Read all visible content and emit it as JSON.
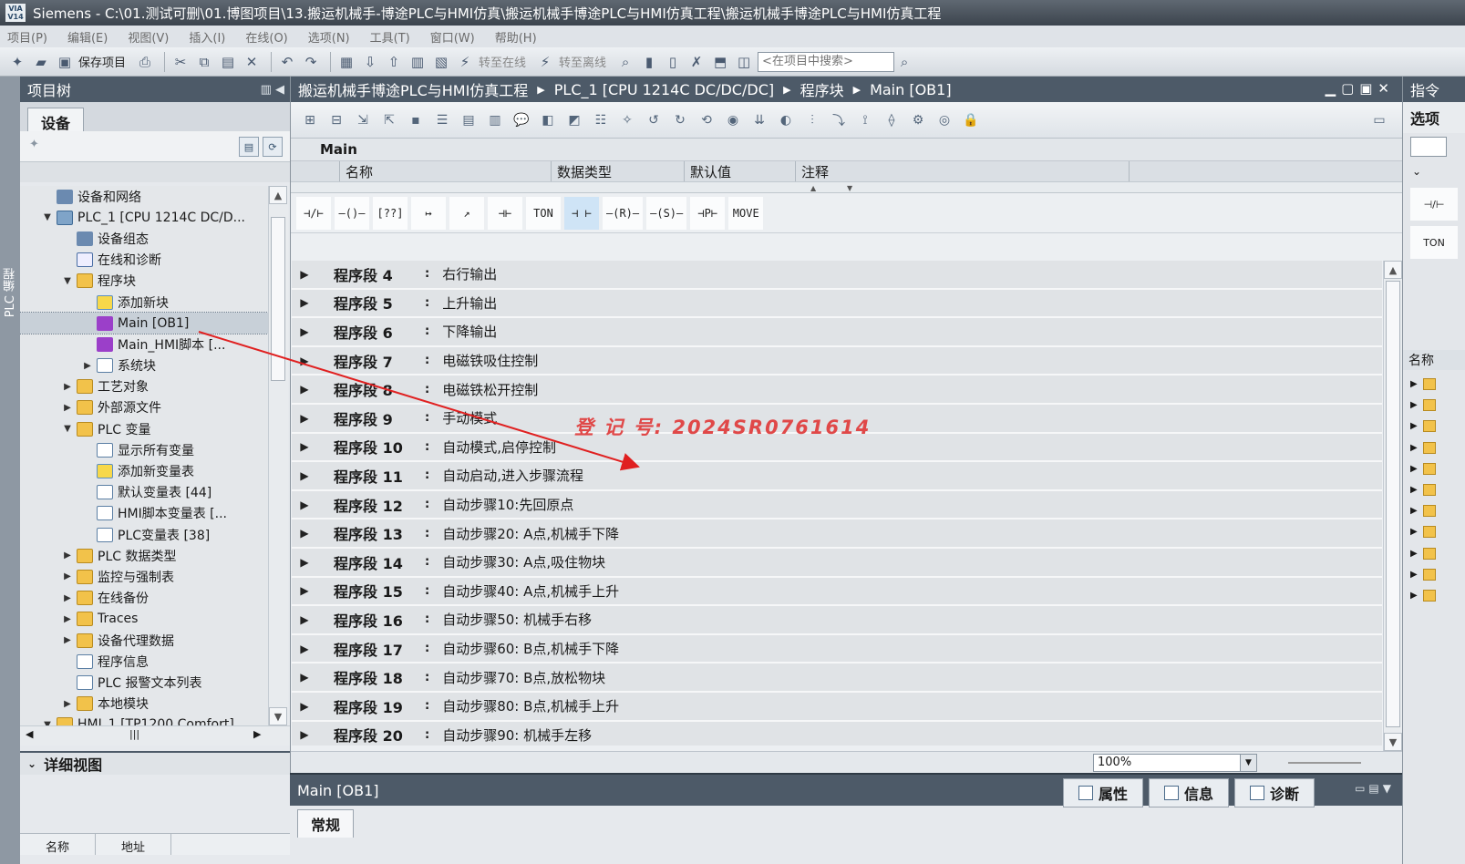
{
  "window": {
    "logo_text": "VIA\nV14",
    "title": "Siemens  -  C:\\01.测试可删\\01.博图项目\\13.搬运机械手-博途PLC与HMI仿真\\搬运机械手博途PLC与HMI仿真工程\\搬运机械手博途PLC与HMI仿真工程"
  },
  "menu": [
    "项目(P)",
    "编辑(E)",
    "视图(V)",
    "插入(I)",
    "在线(O)",
    "选项(N)",
    "工具(T)",
    "窗口(W)",
    "帮助(H)"
  ],
  "toolbar": {
    "save_label": "保存项目",
    "go_online_label": "转至在线",
    "go_offline_label": "转至离线",
    "search_placeholder": "<在项目中搜索>"
  },
  "left_strip_label": "PLC 编程",
  "project_tree": {
    "title": "项目树",
    "tab": "设备",
    "items": [
      {
        "label": "设备和网络",
        "icon": "network-icon",
        "indent": 1,
        "toggle": ""
      },
      {
        "label": "PLC_1 [CPU 1214C DC/D...",
        "icon": "plc-icon",
        "indent": 1,
        "toggle": "▼"
      },
      {
        "label": "设备组态",
        "icon": "device-config-icon",
        "indent": 2,
        "toggle": ""
      },
      {
        "label": "在线和诊断",
        "icon": "online-diagnostics-icon",
        "indent": 2,
        "toggle": ""
      },
      {
        "label": "程序块",
        "icon": "folder-icon",
        "indent": 2,
        "toggle": "▼"
      },
      {
        "label": "添加新块",
        "icon": "add-block-icon",
        "indent": 3,
        "toggle": ""
      },
      {
        "label": "Main [OB1]",
        "icon": "ob-block-icon",
        "indent": 3,
        "toggle": "",
        "selected": true
      },
      {
        "label": "Main_HMI脚本 [...",
        "icon": "ob-block-icon",
        "indent": 3,
        "toggle": ""
      },
      {
        "label": "系统块",
        "icon": "system-block-icon",
        "indent": 3,
        "toggle": "▶"
      },
      {
        "label": "工艺对象",
        "icon": "folder-icon",
        "indent": 2,
        "toggle": "▶"
      },
      {
        "label": "外部源文件",
        "icon": "folder-icon",
        "indent": 2,
        "toggle": "▶"
      },
      {
        "label": "PLC 变量",
        "icon": "folder-icon",
        "indent": 2,
        "toggle": "▼"
      },
      {
        "label": "显示所有变量",
        "icon": "tag-table-icon",
        "indent": 3,
        "toggle": ""
      },
      {
        "label": "添加新变量表",
        "icon": "add-tag-table-icon",
        "indent": 3,
        "toggle": ""
      },
      {
        "label": "默认变量表 [44]",
        "icon": "tag-table-icon",
        "indent": 3,
        "toggle": ""
      },
      {
        "label": "HMI脚本变量表 [...",
        "icon": "tag-table-icon",
        "indent": 3,
        "toggle": ""
      },
      {
        "label": "PLC变量表 [38]",
        "icon": "tag-table-icon",
        "indent": 3,
        "toggle": ""
      },
      {
        "label": "PLC 数据类型",
        "icon": "folder-icon",
        "indent": 2,
        "toggle": "▶"
      },
      {
        "label": "监控与强制表",
        "icon": "folder-icon",
        "indent": 2,
        "toggle": "▶"
      },
      {
        "label": "在线备份",
        "icon": "folder-icon",
        "indent": 2,
        "toggle": "▶"
      },
      {
        "label": "Traces",
        "icon": "folder-icon",
        "indent": 2,
        "toggle": "▶"
      },
      {
        "label": "设备代理数据",
        "icon": "folder-icon",
        "indent": 2,
        "toggle": "▶"
      },
      {
        "label": "程序信息",
        "icon": "doc-icon",
        "indent": 2,
        "toggle": ""
      },
      {
        "label": "PLC 报警文本列表",
        "icon": "doc-icon",
        "indent": 2,
        "toggle": ""
      },
      {
        "label": "本地模块",
        "icon": "folder-icon",
        "indent": 2,
        "toggle": "▶"
      },
      {
        "label": "HMI_1 [TP1200 Comfort]",
        "icon": "folder-icon",
        "indent": 1,
        "toggle": "▼"
      }
    ]
  },
  "detail_view": {
    "title": "详细视图",
    "columns": [
      "名称",
      "地址"
    ]
  },
  "editor": {
    "breadcrumb": [
      "搬运机械手博途PLC与HMI仿真工程",
      "PLC_1 [CPU 1214C DC/DC/DC]",
      "程序块",
      "Main [OB1]"
    ],
    "block_name": "Main",
    "interface_columns": [
      "名称",
      "数据类型",
      "默认值",
      "注释"
    ],
    "ladder_elements": [
      "⊣/⊢",
      "–()–",
      "[??]",
      "↦",
      "↗",
      "⊣⊢",
      "TON",
      "⊣ ⊢",
      "–(R)–",
      "–(S)–",
      "⊣P⊢",
      "MOVE"
    ],
    "networks": [
      {
        "label": "程序段 4",
        "comment": "右行输出"
      },
      {
        "label": "程序段 5",
        "comment": "上升输出"
      },
      {
        "label": "程序段 6",
        "comment": "下降输出"
      },
      {
        "label": "程序段 7",
        "comment": "电磁铁吸住控制"
      },
      {
        "label": "程序段 8",
        "comment": "电磁铁松开控制"
      },
      {
        "label": "程序段 9",
        "comment": "手动模式"
      },
      {
        "label": "程序段 10",
        "comment": "自动模式,启停控制"
      },
      {
        "label": "程序段 11",
        "comment": "自动启动,进入步骤流程"
      },
      {
        "label": "程序段 12",
        "comment": "自动步骤10:先回原点"
      },
      {
        "label": "程序段 13",
        "comment": "自动步骤20: A点,机械手下降"
      },
      {
        "label": "程序段 14",
        "comment": "自动步骤30: A点,吸住物块"
      },
      {
        "label": "程序段 15",
        "comment": "自动步骤40: A点,机械手上升"
      },
      {
        "label": "程序段 16",
        "comment": "自动步骤50: 机械手右移"
      },
      {
        "label": "程序段 17",
        "comment": "自动步骤60: B点,机械手下降"
      },
      {
        "label": "程序段 18",
        "comment": "自动步骤70: B点,放松物块"
      },
      {
        "label": "程序段 19",
        "comment": "自动步骤80: B点,机械手上升"
      },
      {
        "label": "程序段 20",
        "comment": "自动步骤90: 机械手左移"
      }
    ],
    "zoom": "100%"
  },
  "inspector": {
    "title": "Main [OB1]",
    "tabs": [
      "属性",
      "信息",
      "诊断"
    ],
    "subtab": "常规"
  },
  "right_panel": {
    "title": "指令",
    "subtitle": "选项",
    "column": "名称",
    "mini_label": "TON"
  },
  "watermark": "登 记 号:  2024SR0761614",
  "colors": {
    "panel_header": "#4d5a68",
    "watermark": "#e04848",
    "arrow": "#e02020"
  }
}
